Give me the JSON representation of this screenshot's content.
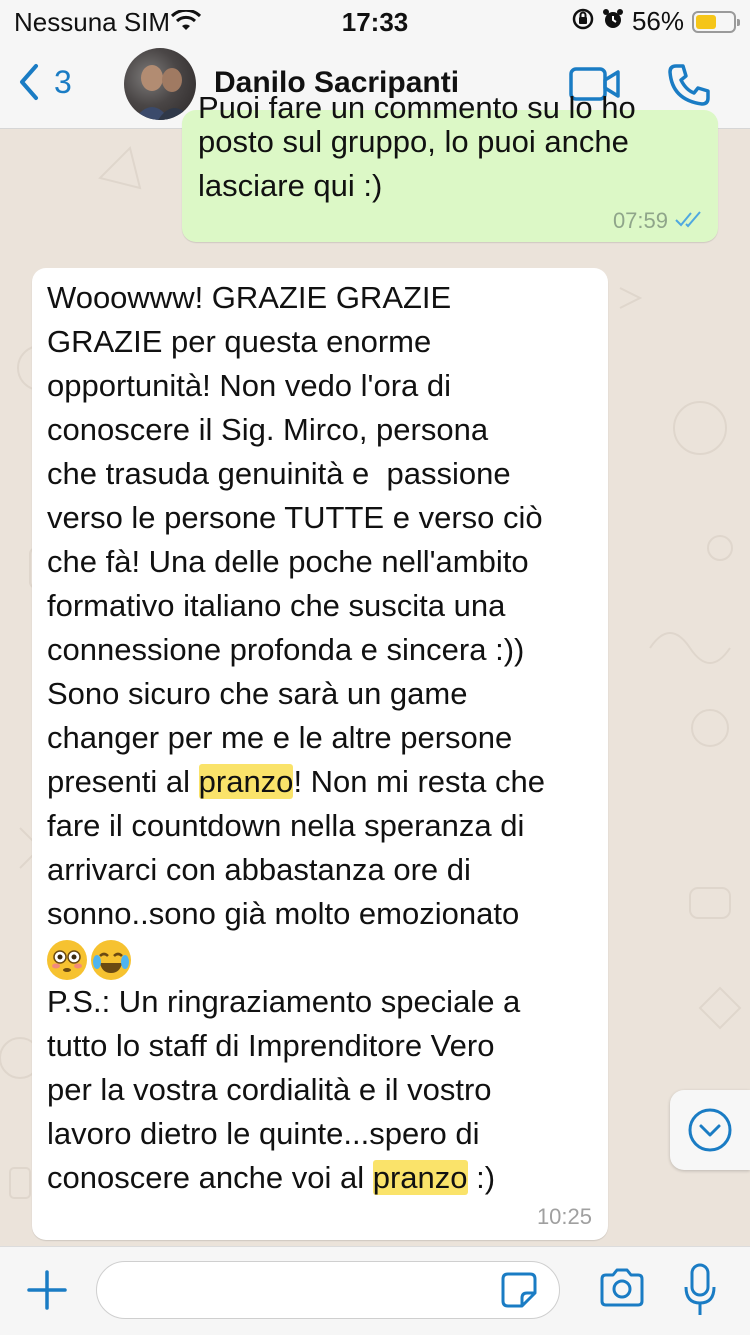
{
  "status_bar": {
    "carrier": "Nessuna SIM",
    "time": "17:33",
    "battery": "56%",
    "battery_level": 0.56,
    "battery_color": "#f5c518"
  },
  "header": {
    "back_count": "3",
    "contact_name": "Danilo Sacripanti",
    "accent_color": "#1a7cc4"
  },
  "messages": [
    {
      "direction": "out",
      "cut_text": "Puoi fare un commento su lo ho",
      "text": "posto sul gruppo, lo puoi anche\nlasciare qui :)",
      "time": "07:59",
      "status_icon": "double-check-icon",
      "bubble_color": "#dcf8c6"
    },
    {
      "direction": "in",
      "segments": [
        "Wooowww! GRAZIE GRAZIE\nGRAZIE per questa enorme\nopportunità! Non vedo l'ora di\nconoscere il Sig. Mirco, persona\nche trasuda genuinità e  passione\nverso le persone TUTTE e verso ciò\nche fà! Una delle poche nell'ambito\nformativo italiano che suscita una\nconnessione profonda e sincera :))\nSono sicuro che sarà un game\nchanger per me e le altre persone\npresenti al ",
        "pranzo",
        "! Non mi resta che\nfare il countdown nella speranza di\narrivarci con abbastanza ore di\nsonno..sono già molto emozionato\n",
        "\nP.S.: Un ringraziamento speciale a\ntutto lo staff di Imprenditore Vero\nper la vostra cordialità e il vostro\nlavoro dietro le quinte...spero di\nconoscere anche voi al ",
        "pranzo",
        " :)"
      ],
      "emojis": [
        "flushed-face-emoji",
        "tears-of-joy-emoji"
      ],
      "highlight_color": "#fae36a",
      "time": "10:25"
    }
  ],
  "input_bar": {
    "placeholder": ""
  }
}
